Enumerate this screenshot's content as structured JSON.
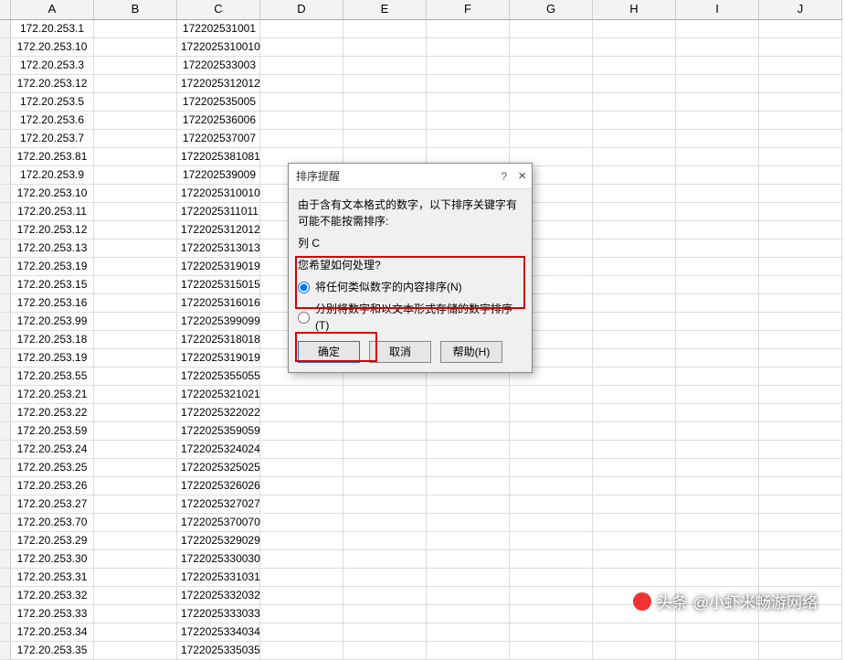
{
  "columns": [
    "A",
    "B",
    "C",
    "D",
    "E",
    "F",
    "G",
    "H",
    "I",
    "J"
  ],
  "rows": [
    {
      "a": "172.20.253.1",
      "c": "172202531001"
    },
    {
      "a": "172.20.253.10",
      "c": "1722025310010"
    },
    {
      "a": "172.20.253.3",
      "c": "172202533003"
    },
    {
      "a": "172.20.253.12",
      "c": "1722025312012"
    },
    {
      "a": "172.20.253.5",
      "c": "172202535005"
    },
    {
      "a": "172.20.253.6",
      "c": "172202536006"
    },
    {
      "a": "172.20.253.7",
      "c": "172202537007"
    },
    {
      "a": "172.20.253.81",
      "c": "1722025381081"
    },
    {
      "a": "172.20.253.9",
      "c": "172202539009"
    },
    {
      "a": "172.20.253.10",
      "c": "1722025310010"
    },
    {
      "a": "172.20.253.11",
      "c": "1722025311011"
    },
    {
      "a": "172.20.253.12",
      "c": "1722025312012"
    },
    {
      "a": "172.20.253.13",
      "c": "1722025313013"
    },
    {
      "a": "172.20.253.19",
      "c": "1722025319019"
    },
    {
      "a": "172.20.253.15",
      "c": "1722025315015"
    },
    {
      "a": "172.20.253.16",
      "c": "1722025316016"
    },
    {
      "a": "172.20.253.99",
      "c": "1722025399099"
    },
    {
      "a": "172.20.253.18",
      "c": "1722025318018"
    },
    {
      "a": "172.20.253.19",
      "c": "1722025319019"
    },
    {
      "a": "172.20.253.55",
      "c": "1722025355055"
    },
    {
      "a": "172.20.253.21",
      "c": "1722025321021"
    },
    {
      "a": "172.20.253.22",
      "c": "1722025322022"
    },
    {
      "a": "172.20.253.59",
      "c": "1722025359059"
    },
    {
      "a": "172.20.253.24",
      "c": "1722025324024"
    },
    {
      "a": "172.20.253.25",
      "c": "1722025325025"
    },
    {
      "a": "172.20.253.26",
      "c": "1722025326026"
    },
    {
      "a": "172.20.253.27",
      "c": "1722025327027"
    },
    {
      "a": "172.20.253.70",
      "c": "1722025370070"
    },
    {
      "a": "172.20.253.29",
      "c": "1722025329029"
    },
    {
      "a": "172.20.253.30",
      "c": "1722025330030"
    },
    {
      "a": "172.20.253.31",
      "c": "1722025331031"
    },
    {
      "a": "172.20.253.32",
      "c": "1722025332032"
    },
    {
      "a": "172.20.253.33",
      "c": "1722025333033"
    },
    {
      "a": "172.20.253.34",
      "c": "1722025334034"
    },
    {
      "a": "172.20.253.35",
      "c": "1722025335035"
    }
  ],
  "dialog": {
    "title": "排序提醒",
    "help": "?",
    "close": "×",
    "line1": "由于含有文本格式的数字，以下排序关键字有",
    "line2": "可能不能按需排序:",
    "column_label": "列 C",
    "prompt": "您希望如何处理?",
    "opt1": "将任何类似数字的内容排序(N)",
    "opt2": "分别将数字和以文本形式存储的数字排序(T)",
    "ok": "确定",
    "cancel": "取消",
    "help_btn": "帮助(H)"
  },
  "watermark": {
    "prefix": "头条",
    "handle": "@小虾米畅游网络"
  }
}
